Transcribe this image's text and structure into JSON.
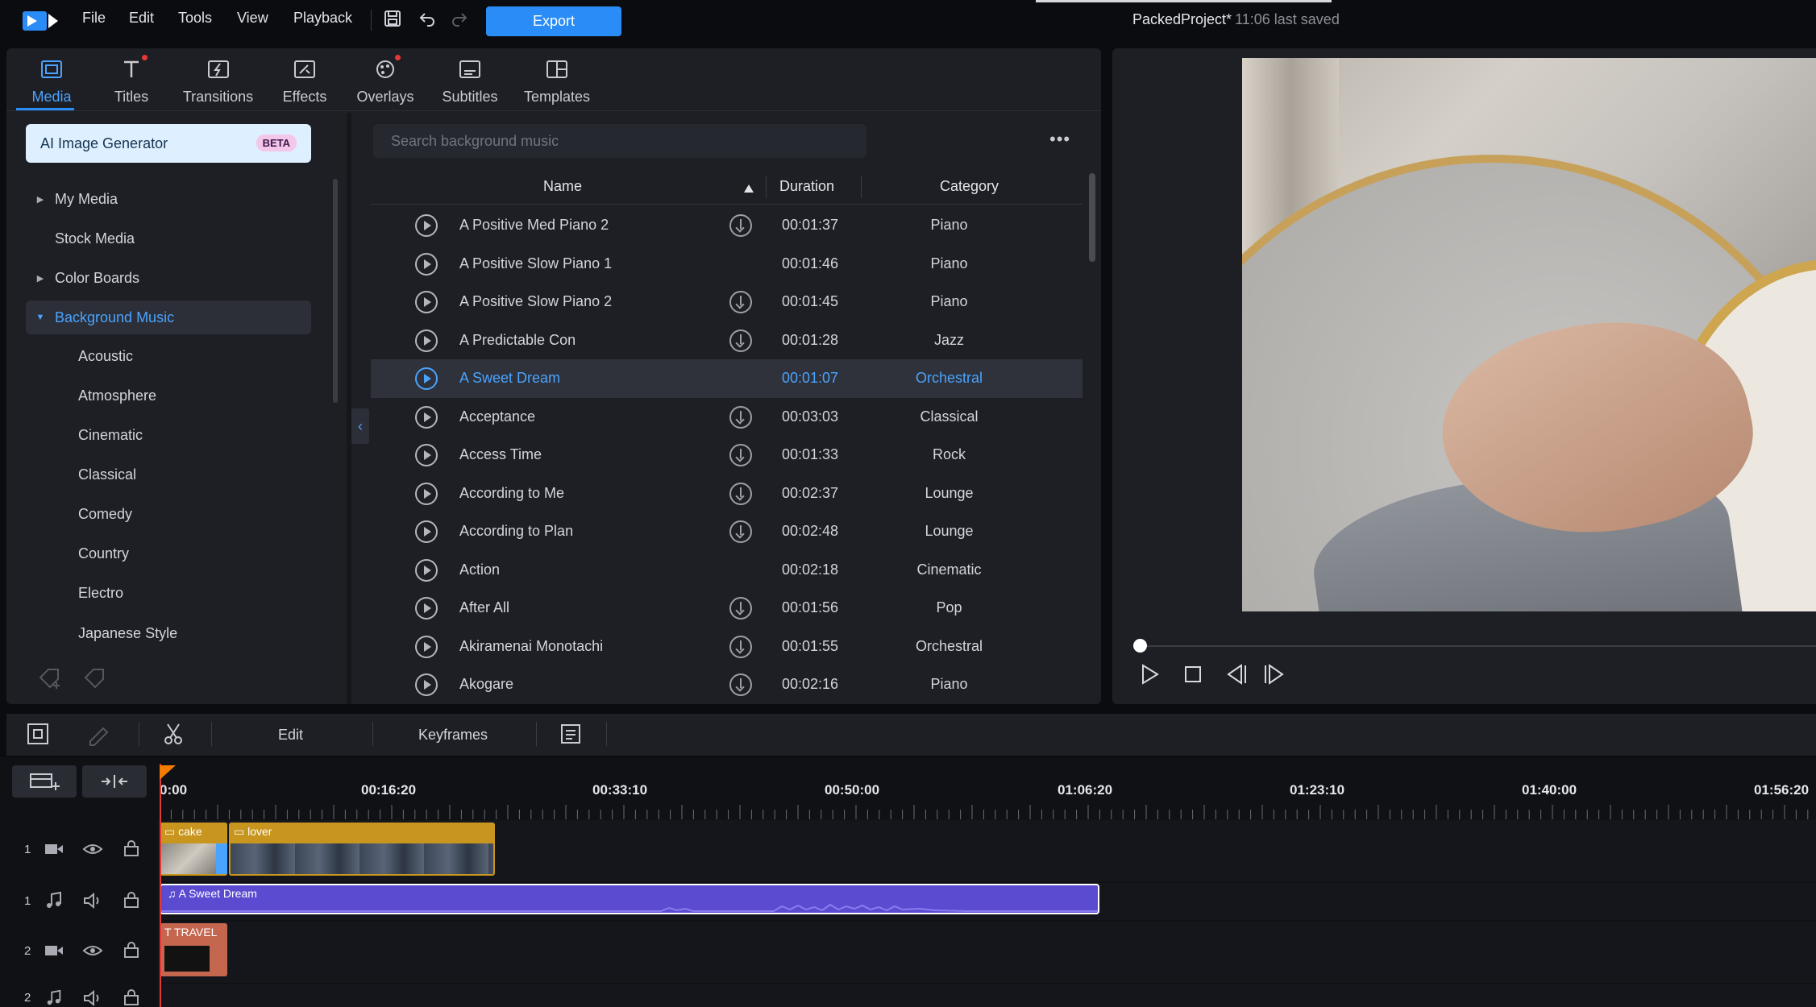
{
  "menu": {
    "items": [
      "File",
      "Edit",
      "Tools",
      "View",
      "Playback"
    ],
    "export_label": "Export"
  },
  "project": {
    "name": "PackedProject*",
    "saved": "11:06 last saved"
  },
  "room_tabs": [
    {
      "label": "Media",
      "icon": "media-icon"
    },
    {
      "label": "Titles",
      "icon": "titles-icon"
    },
    {
      "label": "Transitions",
      "icon": "transitions-icon"
    },
    {
      "label": "Effects",
      "icon": "effects-icon"
    },
    {
      "label": "Overlays",
      "icon": "overlays-icon"
    },
    {
      "label": "Subtitles",
      "icon": "subtitles-icon"
    },
    {
      "label": "Templates",
      "icon": "templates-icon"
    }
  ],
  "library": {
    "ai_button": "AI Image Generator",
    "beta": "BETA",
    "tree": [
      "My Media",
      "Stock Media",
      "Color Boards",
      "Background Music"
    ],
    "music_categories": [
      "Acoustic",
      "Atmosphere",
      "Cinematic",
      "Classical",
      "Comedy",
      "Country",
      "Electro",
      "Japanese Style"
    ],
    "search_placeholder": "Search background music"
  },
  "table": {
    "headers": {
      "name": "Name",
      "duration": "Duration",
      "category": "Category"
    },
    "rows": [
      {
        "name": "A Positive Med Piano 2",
        "duration": "00:01:37",
        "category": "Piano",
        "download": true
      },
      {
        "name": "A Positive Slow Piano 1",
        "duration": "00:01:46",
        "category": "Piano",
        "download": false
      },
      {
        "name": "A Positive Slow Piano 2",
        "duration": "00:01:45",
        "category": "Piano",
        "download": true
      },
      {
        "name": "A Predictable Con",
        "duration": "00:01:28",
        "category": "Jazz",
        "download": true
      },
      {
        "name": "A Sweet Dream",
        "duration": "00:01:07",
        "category": "Orchestral",
        "download": false,
        "selected": true
      },
      {
        "name": "Acceptance",
        "duration": "00:03:03",
        "category": "Classical",
        "download": true
      },
      {
        "name": "Access Time",
        "duration": "00:01:33",
        "category": "Rock",
        "download": true
      },
      {
        "name": "According to Me",
        "duration": "00:02:37",
        "category": "Lounge",
        "download": true
      },
      {
        "name": "According to Plan",
        "duration": "00:02:48",
        "category": "Lounge",
        "download": true
      },
      {
        "name": "Action",
        "duration": "00:02:18",
        "category": "Cinematic",
        "download": false
      },
      {
        "name": "After All",
        "duration": "00:01:56",
        "category": "Pop",
        "download": true
      },
      {
        "name": "Akiramenai Monotachi",
        "duration": "00:01:55",
        "category": "Orchestral",
        "download": true
      },
      {
        "name": "Akogare",
        "duration": "00:02:16",
        "category": "Piano",
        "download": true
      }
    ]
  },
  "timeline": {
    "edit_label": "Edit",
    "keyframes_label": "Keyframes",
    "ruler": [
      "0:00",
      "00:16:20",
      "00:33:10",
      "00:50:00",
      "01:06:20",
      "01:23:10",
      "01:40:00",
      "01:56:20"
    ],
    "tracks": [
      {
        "num": "1",
        "type": "video"
      },
      {
        "num": "1",
        "type": "audio"
      },
      {
        "num": "2",
        "type": "video"
      },
      {
        "num": "2",
        "type": "audio"
      }
    ],
    "clips": {
      "video1_a": "cake",
      "video1_b": "lover",
      "audio1": "A Sweet Dream",
      "video2": "TRAVEL"
    }
  },
  "colors": {
    "accent": "#2a8cf6",
    "selected_text": "#4aa3ff",
    "video_clip": "#c8961e",
    "audio_clip": "#5b4bd1",
    "title_clip": "#c5674f"
  }
}
